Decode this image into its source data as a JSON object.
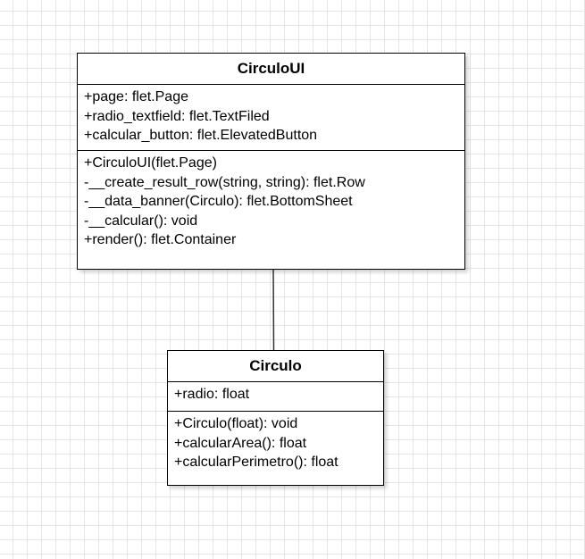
{
  "classes": {
    "circuloui": {
      "name": "CirculoUI",
      "attributes": [
        "+page: flet.Page",
        "+radio_textfield: flet.TextFiled",
        "+calcular_button: flet.ElevatedButton"
      ],
      "methods": [
        "+CirculoUI(flet.Page)",
        "-__create_result_row(string, string): flet.Row",
        "-__data_banner(Circulo): flet.BottomSheet",
        "-__calcular(): void",
        "+render(): flet.Container"
      ]
    },
    "circulo": {
      "name": "Circulo",
      "attributes": [
        "+radio: float"
      ],
      "methods": [
        "+Circulo(float): void",
        "+calcularArea(): float",
        "+calcularPerimetro(): float"
      ]
    }
  }
}
